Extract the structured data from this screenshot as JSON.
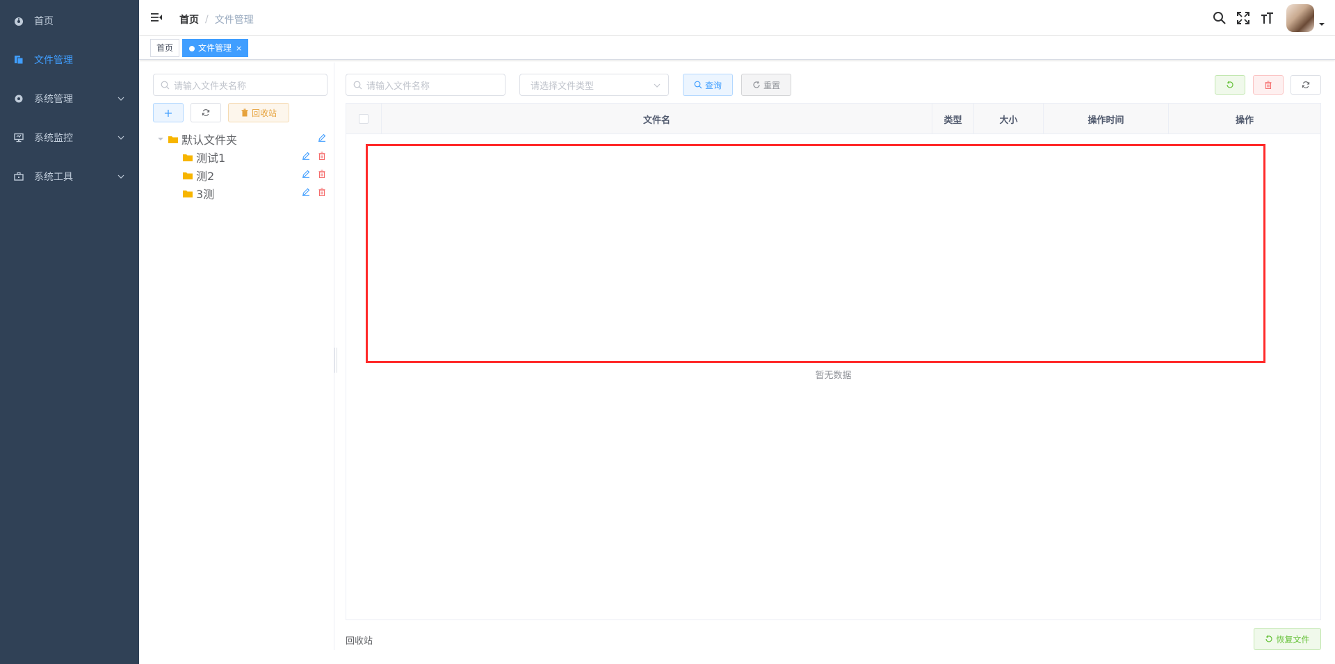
{
  "sidebar": {
    "items": [
      {
        "label": "首页",
        "icon": "dashboard-icon"
      },
      {
        "label": "文件管理",
        "icon": "file-icon",
        "active": true
      },
      {
        "label": "系统管理",
        "icon": "gear-icon"
      },
      {
        "label": "系统监控",
        "icon": "monitor-icon"
      },
      {
        "label": "系统工具",
        "icon": "toolbox-icon"
      }
    ]
  },
  "header": {
    "breadcrumb": [
      "首页",
      "文件管理"
    ]
  },
  "tags": {
    "home": "首页",
    "current": "文件管理",
    "close": "×"
  },
  "left_panel": {
    "search_placeholder": "请输入文件夹名称",
    "add_label": "+",
    "recycle_label": "回收站",
    "tree": {
      "root": "默认文件夹",
      "children": [
        "测试1",
        "测2",
        "3测"
      ]
    }
  },
  "main": {
    "search_placeholder": "请输入文件名称",
    "type_placeholder": "请选择文件类型",
    "query_label": "查询",
    "reset_label": "重置",
    "columns": [
      "文件名",
      "类型",
      "大小",
      "操作时间",
      "操作"
    ],
    "empty_text": "暂无数据",
    "footer_label": "回收站",
    "restore_label": "恢复文件"
  },
  "colors": {
    "sidebar_bg": "#304156",
    "primary": "#409eff",
    "success": "#67c23a",
    "danger": "#f56c6c",
    "warning": "#e6a23c",
    "highlight_box": "#ff2a2a"
  }
}
